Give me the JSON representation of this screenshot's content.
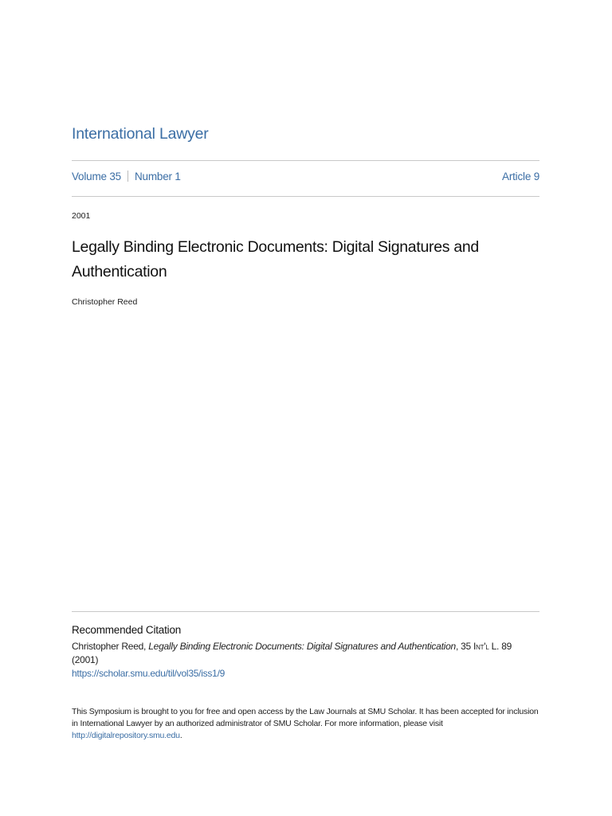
{
  "journal": "International Lawyer",
  "volume": "Volume 35",
  "number": "Number 1",
  "article": "Article 9",
  "year": "2001",
  "title": "Legally Binding Electronic Documents: Digital Signatures and Authentication",
  "author": "Christopher Reed",
  "citation": {
    "heading": "Recommended Citation",
    "author_prefix": "Christopher Reed, ",
    "title_italic": "Legally Binding Electronic Documents: Digital Signatures and Authentication",
    "volume_prefix": ", 35 ",
    "journal_abbrev": "Int'l L.",
    "pages_year": " 89 (2001)",
    "url": "https://scholar.smu.edu/til/vol35/iss1/9"
  },
  "footer": {
    "text": "This Symposium is brought to you for free and open access by the Law Journals at SMU Scholar. It has been accepted for inclusion in International Lawyer by an authorized administrator of SMU Scholar. For more information, please visit ",
    "link": "http://digitalrepository.smu.edu",
    "end": "."
  }
}
